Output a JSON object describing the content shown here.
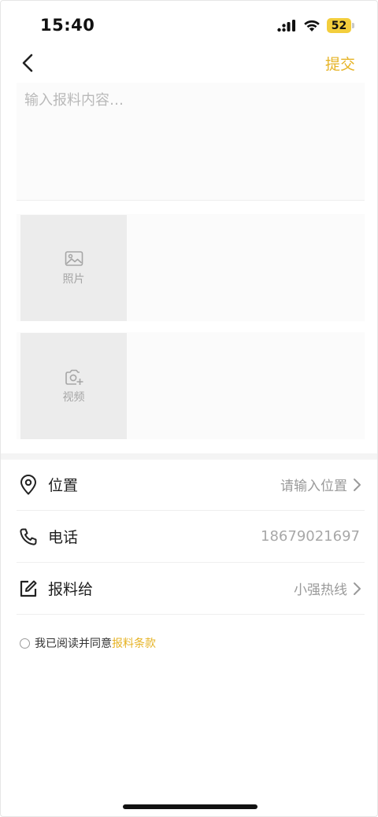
{
  "status_bar": {
    "time": "15:40",
    "battery": "52",
    "battery_color": "#f3ce3c"
  },
  "nav": {
    "back_icon": "chevron-left-icon",
    "submit_label": "提交",
    "accent_color": "#e6b325"
  },
  "content": {
    "placeholder": "输入报料内容…",
    "value": ""
  },
  "media": {
    "photo": {
      "icon": "image-icon",
      "label": "照片"
    },
    "video": {
      "icon": "camera-plus-icon",
      "label": "视频"
    }
  },
  "form": {
    "location": {
      "icon": "location-pin-icon",
      "label": "位置",
      "value": "请输入位置"
    },
    "phone": {
      "icon": "phone-icon",
      "label": "电话",
      "value": "18679021697"
    },
    "report_to": {
      "icon": "edit-icon",
      "label": "报料给",
      "value": "小强热线"
    }
  },
  "agreement": {
    "text": "我已阅读并同意",
    "link": "报料条款"
  }
}
